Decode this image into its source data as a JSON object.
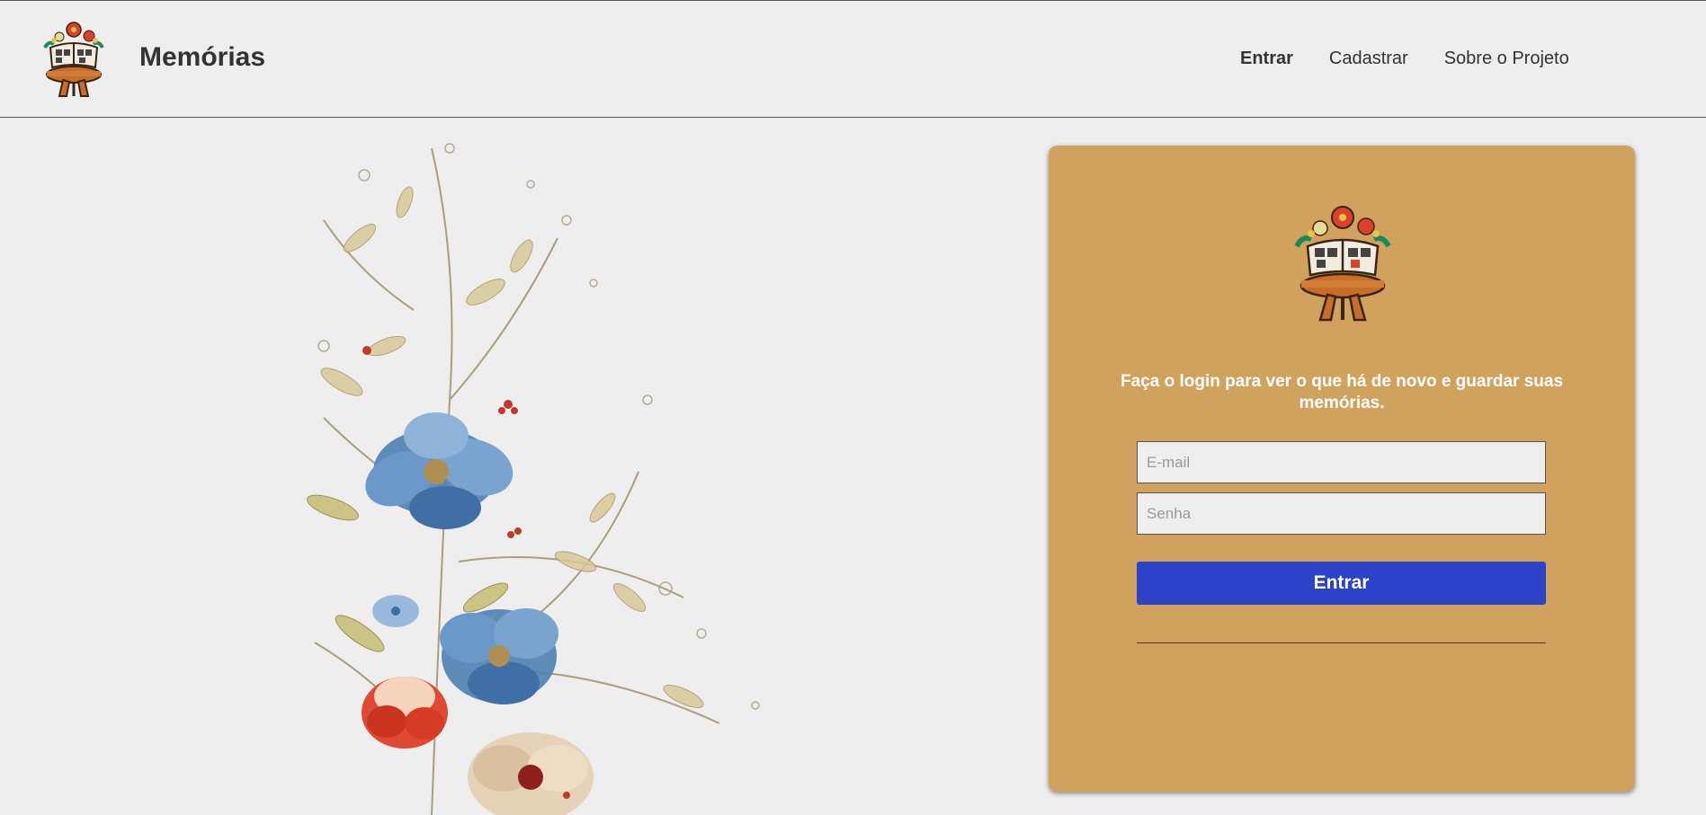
{
  "header": {
    "brand_title": "Memórias",
    "logo_icon": "book-flower-table-icon"
  },
  "nav": {
    "items": [
      {
        "label": "Entrar",
        "active": true
      },
      {
        "label": "Cadastrar",
        "active": false
      },
      {
        "label": "Sobre o Projeto",
        "active": false
      }
    ]
  },
  "login": {
    "logo_icon": "book-flower-table-icon",
    "heading": "Faça o login para ver o que há de novo e guardar suas memórias.",
    "email_placeholder": "E-mail",
    "email_value": "",
    "password_placeholder": "Senha",
    "password_value": "",
    "submit_label": "Entrar"
  },
  "illustration": "floral-illustration",
  "colors": {
    "background": "#eeeeee",
    "card": "#d1a25e",
    "button": "#2b42c9",
    "text": "#333333"
  }
}
